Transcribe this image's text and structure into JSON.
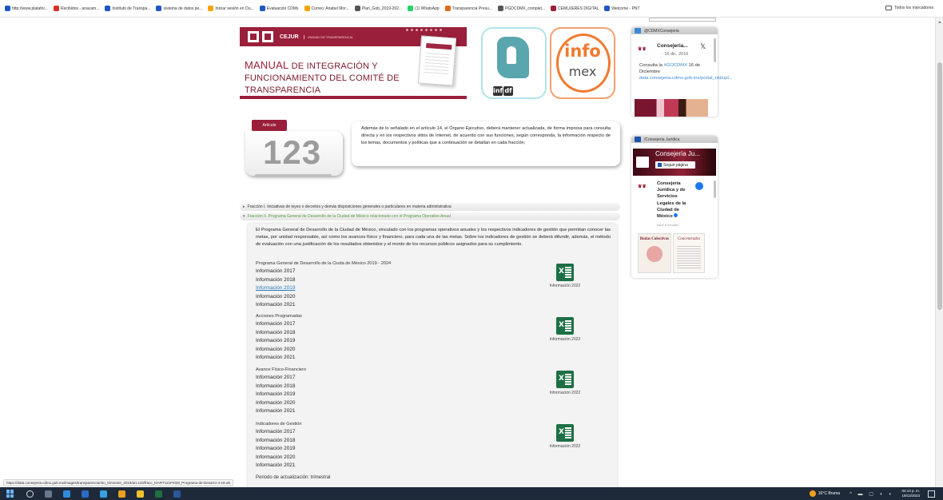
{
  "bookmarks": [
    {
      "label": "http://www.platafor...",
      "color": "#1e56c4"
    },
    {
      "label": "Recibidos - anacam...",
      "color": "#d93025"
    },
    {
      "label": "Instituto de Transpa...",
      "color": "#1e56c4"
    },
    {
      "label": "sistema de datos pe...",
      "color": "#1e56c4"
    },
    {
      "label": "Iniciar sesión en Ou...",
      "color": "#f4a300"
    },
    {
      "label": "Evaluación CDMx",
      "color": "#1e56c4"
    },
    {
      "label": "Correo: Anabel Mor...",
      "color": "#f4a300"
    },
    {
      "label": "Plan_Gob_2019-202...",
      "color": "#555555"
    },
    {
      "label": "(1) WhatsApp",
      "color": "#25d366"
    },
    {
      "label": "Transparencia Presu...",
      "color": "#e06a1c"
    },
    {
      "label": "PGDCDMX_complet...",
      "color": "#555555"
    },
    {
      "label": "CEMUJERES DIGITAL",
      "color": "#9a1f3a"
    },
    {
      "label": "Welcome - PNT",
      "color": "#1e56c4"
    }
  ],
  "bookmarks_all": "Todos los marcadores",
  "banner": {
    "brand": "CEJUR",
    "unit": "UNIDAD DE TRANSPARENCIA",
    "manual_lead": "MANUAL",
    "manual_rest": " DE INTEGRACIÓN Y FUNCIONAMIENTO DEL COMITÉ DE TRANSPARENCIA"
  },
  "infodf": {
    "word": "info",
    "badge": "df"
  },
  "infomex": {
    "word1": "info",
    "word2": "mex"
  },
  "articulo": {
    "tag": "Artículo",
    "number": "123",
    "text": "Además de lo señalado en el artículo 14, el Órgano Ejecutivo, deberá mantener actualizada, de forma impresa para consulta directa y en los respectivos sitios de Internet, de acuerdo con sus funciones, según corresponda, la información respecto de los temas, documentos y políticas que a continuación se detallan en cada fracción;"
  },
  "fracciones": [
    {
      "label": "Fracción I. Iniciativas de leyes o decretos y demás disposiciones generales o particulares en materia administrativa"
    },
    {
      "label": "Fracción II. Programa General de Desarrollo de la Ciudad de México relacionado con el Programa Operativo Anual"
    }
  ],
  "content": {
    "description": "El Programa General de Desarrollo de la Ciudad de México, vinculado con los programas operativos anuales y los respectivos indicadores de gestión que permitan conocer las metas, por unidad responsable, así como los avances físico y financiero, para cada una de las metas. Sobre los indicadores de gestión se deberá difundir, además, el método de evaluación con una justificación de los resultados obtenidos y el monto de los recursos públicos asignados para su cumplimiento.",
    "sections": [
      {
        "title": "Programa General de Desarrollo de la Ciuda de México 2019 - 2024",
        "links": [
          "Información 2017",
          "Información 2018",
          "Información 2019",
          "Información 2020",
          "Información 2021"
        ],
        "excel": "Información 2022"
      },
      {
        "title": "Acciones Programadas",
        "links": [
          "Información 2017",
          "Información 2018",
          "Información 2019",
          "Información 2020",
          "Información 2021"
        ],
        "excel": "Información 2022"
      },
      {
        "title": "Avance Físico-Financiero",
        "links": [
          "Información 2017",
          "Información 2018",
          "Información 2019",
          "Información 2020",
          "Información 2021"
        ],
        "excel": "Información 2022"
      },
      {
        "title": "Indicadores de Gestión",
        "links": [
          "Información 2017",
          "Información 2018",
          "Información 2019",
          "Información 2020",
          "Información 2021"
        ],
        "excel": "Información 2022"
      }
    ],
    "periodo": "Periodo de actualización: trimestral"
  },
  "twitter": {
    "header": "@CDMXConsejeria",
    "name": "Consejeria...",
    "date": "· 16 dic. 2016",
    "body_text": "Consulta la ",
    "hashtag": "#GOCDMX",
    "body_rest": " 16 de Diciembre ",
    "link": "data.consejeria.cdmx.gob.mx/portal_old/upl..."
  },
  "facebook": {
    "header": "/Consejería Jurídica",
    "page_name": "Consejería Ju...",
    "follow": "Seguir página",
    "post_name": "Consejería Jurídica y de Servicios Legales de la Ciudad de México",
    "post_time": "hace 6 minutos",
    "img1": "Bodas Colectivas",
    "img2": "Concentrados"
  },
  "status_url": "https://data.consejeria.cdmx.gob.mx/images/transparencia/4to_trimestre_2019/art.123/fracc_II/ART121FI028_Programa-de-Desarro-4-19.xls",
  "taskbar": {
    "weather": "16°C Bruma",
    "time": "02:13 p. m.",
    "date": "19/12/2023"
  }
}
